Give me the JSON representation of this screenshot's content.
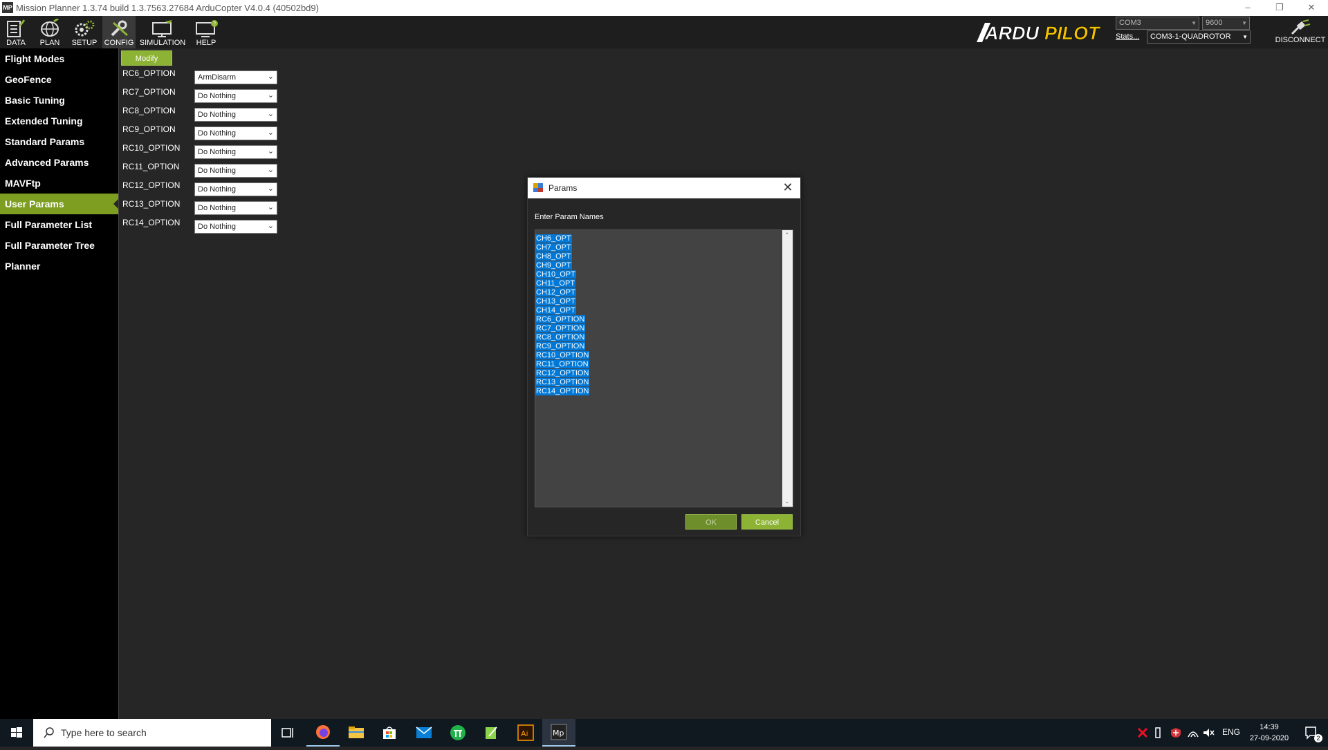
{
  "window": {
    "title": "Mission Planner 1.3.74 build 1.3.7563.27684 ArduCopter V4.0.4 (40502bd9)",
    "app_icon": "MP"
  },
  "toolbar": {
    "buttons": [
      {
        "label": "DATA",
        "icon": "data-icon"
      },
      {
        "label": "PLAN",
        "icon": "globe-icon"
      },
      {
        "label": "SETUP",
        "icon": "gears-icon"
      },
      {
        "label": "CONFIG",
        "icon": "wrench-icon"
      },
      {
        "label": "SIMULATION",
        "icon": "monitor-plane-icon"
      },
      {
        "label": "HELP",
        "icon": "help-monitor-icon"
      }
    ],
    "logo_text": "ARDUPILOT",
    "com_port": "COM3",
    "baud": "9600",
    "stats_label": "Stats...",
    "connection": "COM3-1-QUADROTOR",
    "disconnect_label": "DISCONNECT"
  },
  "sidebar": {
    "items": [
      {
        "label": "Flight Modes",
        "active": false
      },
      {
        "label": "GeoFence",
        "active": false
      },
      {
        "label": "Basic Tuning",
        "active": false
      },
      {
        "label": "Extended Tuning",
        "active": false
      },
      {
        "label": "Standard Params",
        "active": false
      },
      {
        "label": "Advanced Params",
        "active": false
      },
      {
        "label": "MAVFtp",
        "active": false
      },
      {
        "label": "User Params",
        "active": true
      },
      {
        "label": "Full Parameter List",
        "active": false
      },
      {
        "label": "Full Parameter Tree",
        "active": false
      },
      {
        "label": "Planner",
        "active": false
      }
    ]
  },
  "params": {
    "modify_label": "Modify",
    "rows": [
      {
        "name": "RC6_OPTION",
        "value": "ArmDisarm"
      },
      {
        "name": "RC7_OPTION",
        "value": "Do Nothing"
      },
      {
        "name": "RC8_OPTION",
        "value": "Do Nothing"
      },
      {
        "name": "RC9_OPTION",
        "value": "Do Nothing"
      },
      {
        "name": "RC10_OPTION",
        "value": "Do Nothing"
      },
      {
        "name": "RC11_OPTION",
        "value": "Do Nothing"
      },
      {
        "name": "RC12_OPTION",
        "value": "Do Nothing"
      },
      {
        "name": "RC13_OPTION",
        "value": "Do Nothing"
      },
      {
        "name": "RC14_OPTION",
        "value": "Do Nothing"
      }
    ]
  },
  "dialog": {
    "title": "Params",
    "close": "✕",
    "prompt": "Enter Param Names",
    "lines": [
      "CH6_OPT",
      "CH7_OPT",
      "CH8_OPT",
      "CH9_OPT",
      "CH10_OPT",
      "CH11_OPT",
      "CH12_OPT",
      "CH13_OPT",
      "CH14_OPT",
      "RC6_OPTION",
      "RC7_OPTION",
      "RC8_OPTION",
      "RC9_OPTION",
      "RC10_OPTION",
      "RC11_OPTION",
      "RC12_OPTION",
      "RC13_OPTION",
      "RC14_OPTION"
    ],
    "ok_label": "OK",
    "cancel_label": "Cancel"
  },
  "taskbar": {
    "search_placeholder": "Type here to search",
    "lang": "ENG",
    "time": "14:39",
    "date": "27-09-2020",
    "notification_count": "2"
  },
  "colors": {
    "accent_green": "#8db335",
    "sidebar_active": "#7d9e21",
    "selection_blue": "#0078d7"
  }
}
